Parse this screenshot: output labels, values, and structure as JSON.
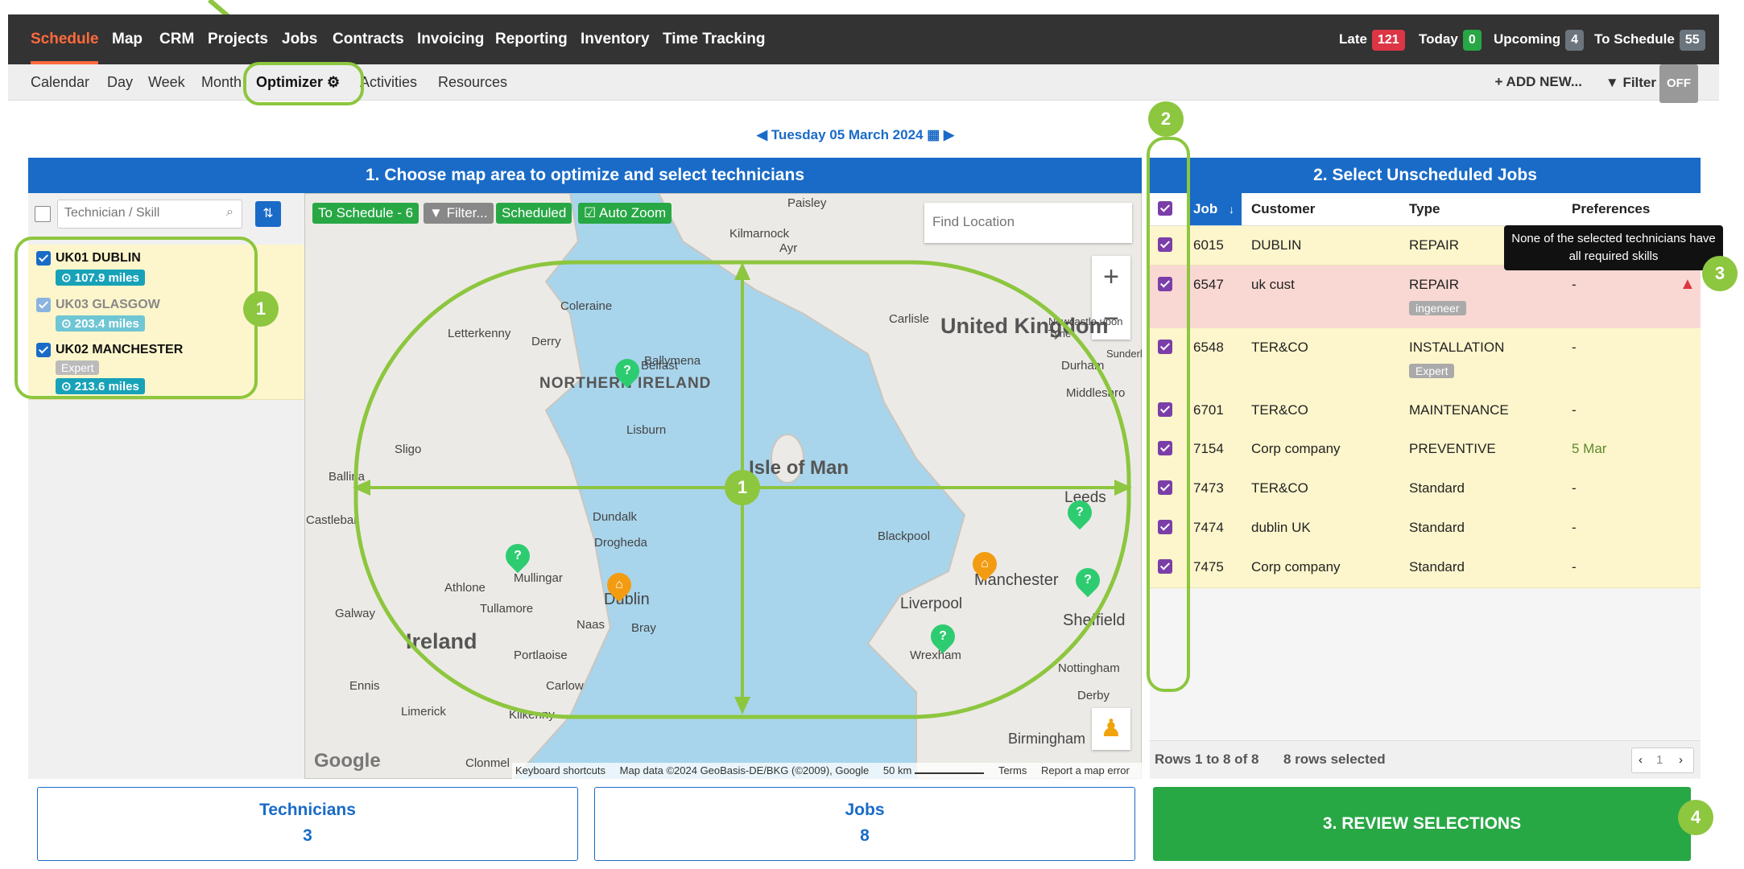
{
  "topnav": {
    "items": [
      "Schedule",
      "Map",
      "CRM",
      "Projects",
      "Jobs",
      "Contracts",
      "Invoicing",
      "Reporting",
      "Inventory",
      "Time Tracking"
    ],
    "counters": [
      {
        "label": "Late",
        "count": "121",
        "color": "#dc3545"
      },
      {
        "label": "Today",
        "count": "0",
        "color": "#28a745"
      },
      {
        "label": "Upcoming",
        "count": "4",
        "color": "#6c757d"
      },
      {
        "label": "To Schedule",
        "count": "55",
        "color": "#6c757d"
      }
    ]
  },
  "subnav": {
    "items": [
      "Calendar",
      "Day",
      "Week",
      "Month",
      "Optimizer",
      "Activities",
      "Resources"
    ],
    "add_new": "+ ADD NEW...",
    "filter": "Filter",
    "filter_state": "OFF"
  },
  "date": "Tuesday 05 March 2024",
  "left": {
    "title": "1. Choose map area to optimize and select technicians",
    "search_placeholder": "Technician / Skill",
    "technicians": [
      {
        "name": "UK01 DUBLIN",
        "miles": "107.9 miles",
        "skill": ""
      },
      {
        "name": "UK03 GLASGOW",
        "miles": "203.4 miles",
        "skill": ""
      },
      {
        "name": "UK02 MANCHESTER",
        "miles": "213.6 miles",
        "skill": "Expert"
      }
    ]
  },
  "map": {
    "to_schedule": "To Schedule - 6",
    "filter": "Filter...",
    "scheduled": "Scheduled",
    "auto_zoom": "Auto Zoom",
    "find_placeholder": "Find Location",
    "labels": [
      "United Kingdom",
      "Isle of Man",
      "NORTHERN IRELAND",
      "Ireland",
      "Belfast",
      "Dublin",
      "Liverpool",
      "Manchester",
      "Leeds",
      "Sheffield",
      "Blackpool",
      "Lisburn",
      "Derry",
      "Coleraine",
      "Galway",
      "Limerick",
      "Birmingham",
      "Kilmarnock",
      "Paisley",
      "Middlesbro",
      "Durham",
      "Drogheda",
      "Dundalk",
      "Athlone",
      "Tullamore",
      "Naas",
      "Bray",
      "Portlaoise",
      "Carlow",
      "Kilkenny",
      "Ennis",
      "Sligo",
      "Ballina",
      "Castlebar",
      "Wrexham",
      "Nottingham",
      "Derby",
      "Carlisle",
      "Newcastle upon Tyne",
      "Sunderland",
      "Mullingar",
      "Letterkenny",
      "Ballymena",
      "Ayr",
      "Clonmel"
    ],
    "footer": [
      "Keyboard shortcuts",
      "Map data ©2024 GeoBasis-DE/BKG (©2009), Google",
      "50 km",
      "Terms",
      "Report a map error"
    ],
    "google": "Google"
  },
  "right": {
    "title": "2. Select Unscheduled Jobs",
    "columns": [
      "Job",
      "Customer",
      "Type",
      "Preferences"
    ],
    "rows": [
      {
        "job": "6015",
        "customer": "DUBLIN",
        "type": "REPAIR",
        "tag": "",
        "pref": ""
      },
      {
        "job": "6547",
        "customer": "uk cust",
        "type": "REPAIR",
        "tag": "ingeneer",
        "pref": "-"
      },
      {
        "job": "6548",
        "customer": "TER&CO",
        "type": "INSTALLATION",
        "tag": "Expert",
        "pref": "-"
      },
      {
        "job": "6701",
        "customer": "TER&CO",
        "type": "MAINTENANCE",
        "tag": "",
        "pref": "-"
      },
      {
        "job": "7154",
        "customer": "Corp company",
        "type": "PREVENTIVE",
        "tag": "",
        "pref": "5 Mar"
      },
      {
        "job": "7473",
        "customer": "TER&CO",
        "type": "Standard",
        "tag": "",
        "pref": "-"
      },
      {
        "job": "7474",
        "customer": "dublin UK",
        "type": "Standard",
        "tag": "",
        "pref": "-"
      },
      {
        "job": "7475",
        "customer": "Corp company",
        "type": "Standard",
        "tag": "",
        "pref": "-"
      }
    ],
    "tooltip": "None of the selected technicians have all required skills",
    "footer_rows": "Rows 1 to 8 of 8",
    "footer_selected": "8 rows selected",
    "page": "1"
  },
  "bottom": {
    "technicians_label": "Technicians",
    "technicians_count": "3",
    "jobs_label": "Jobs",
    "jobs_count": "8",
    "review": "3. REVIEW SELECTIONS"
  },
  "callouts": [
    "1",
    "1",
    "2",
    "3",
    "4"
  ]
}
